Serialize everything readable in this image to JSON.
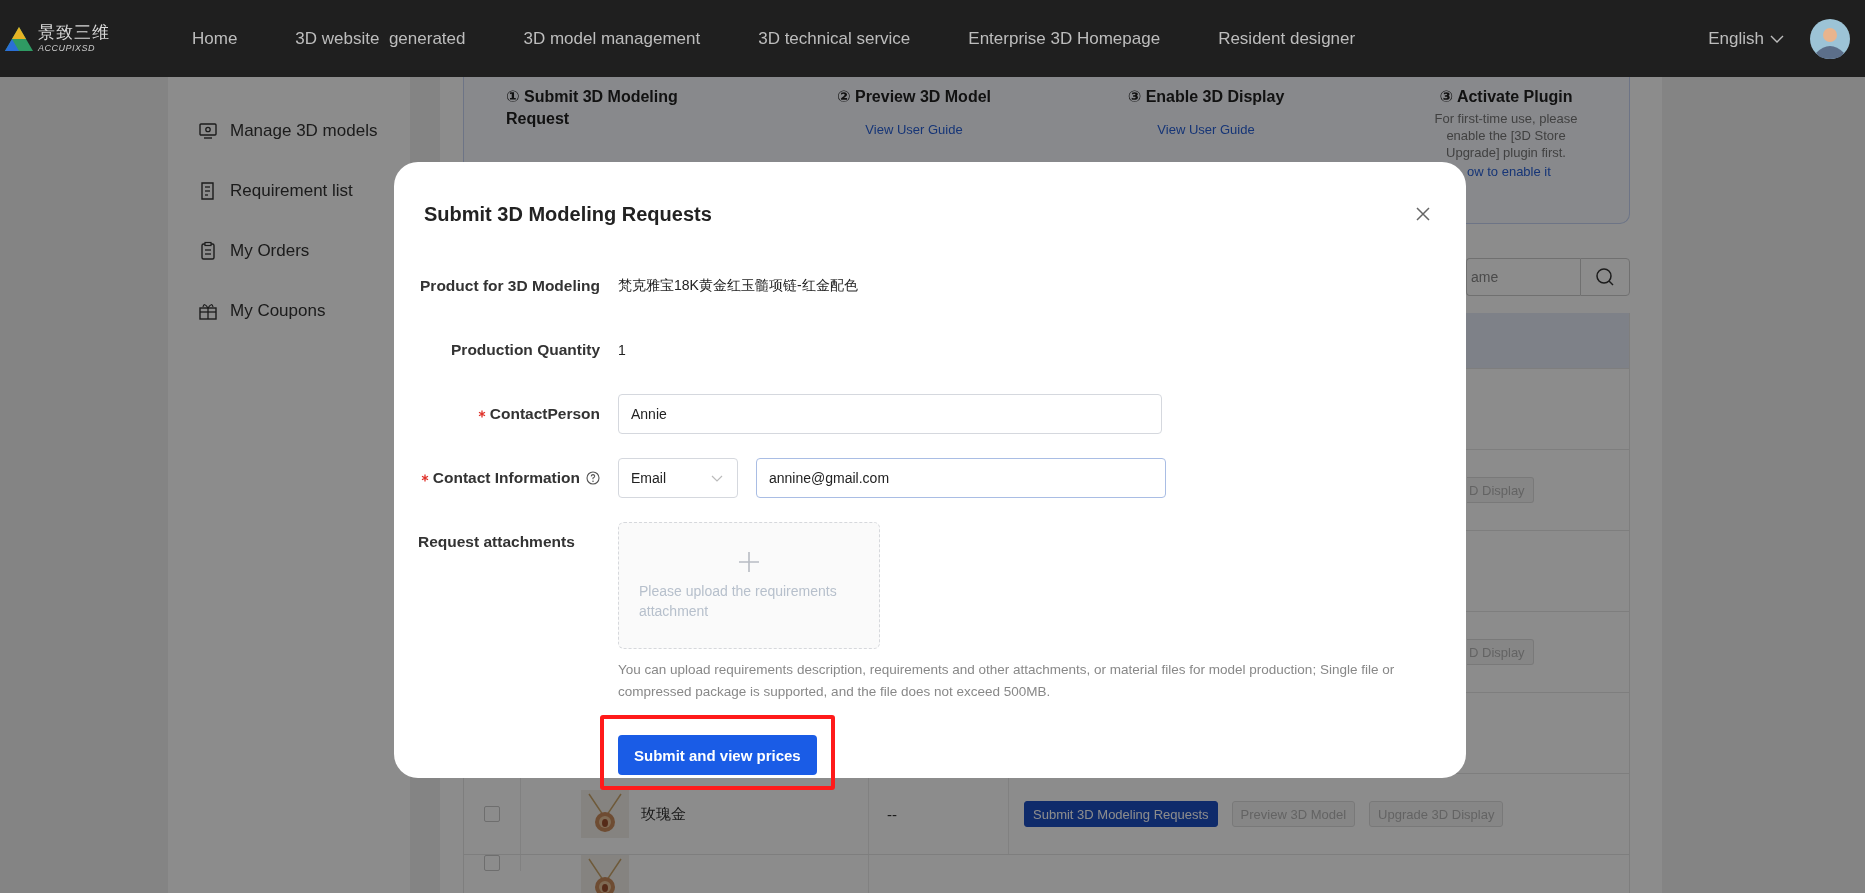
{
  "nav": {
    "logo": {
      "name": "景致三维",
      "sub": "ACCUPIXSD"
    },
    "items": [
      {
        "label": "Home",
        "selected": false
      },
      {
        "label": "3D website  generated",
        "selected": false
      },
      {
        "label": "3D model management",
        "selected": false
      },
      {
        "label": "3D technical service",
        "selected": false
      },
      {
        "label": "Enterprise 3D Homepage",
        "selected": false
      },
      {
        "label": "Resident designer",
        "selected": false
      }
    ],
    "language": "English"
  },
  "sidebar": {
    "items": [
      {
        "label": "Manage 3D models",
        "kind": "monitor"
      },
      {
        "label": "Requirement list",
        "kind": "document"
      },
      {
        "label": "My Orders",
        "kind": "clipboard"
      },
      {
        "label": "My Coupons",
        "kind": "gift"
      }
    ]
  },
  "steps": [
    {
      "title": "① Submit 3D Modeling Request"
    },
    {
      "title": "② Preview 3D Model",
      "link": "View User Guide"
    },
    {
      "title": "③ Enable 3D Display",
      "link": "View User Guide"
    },
    {
      "title": "③ Activate Plugin",
      "note": "For first-time use, please enable the [3D Store Upgrade] plugin first.",
      "link": "ow to enable it"
    }
  ],
  "search": {
    "placeholder": "ame"
  },
  "table": {
    "rows": [
      {
        "kind": "covered"
      },
      {
        "kind": "partial",
        "buttons": [
          {
            "label": "D Display",
            "kind": "disabled"
          }
        ]
      },
      {
        "kind": "covered"
      },
      {
        "kind": "partial",
        "buttons": [
          {
            "label": "D Display",
            "kind": "disabled"
          }
        ]
      },
      {
        "kind": "covered"
      },
      {
        "kind": "full",
        "checked": false,
        "name": "玫瑰金",
        "column_3": "--",
        "buttons": [
          {
            "label": "Submit 3D Modeling Requests",
            "kind": "primary"
          },
          {
            "label": "Preview 3D Model",
            "kind": "disabled"
          },
          {
            "label": "Upgrade 3D Display",
            "kind": "disabled"
          }
        ]
      },
      {
        "kind": "cut",
        "checked": false
      }
    ]
  },
  "modal": {
    "title": "Submit 3D Modeling Requests",
    "fields": [
      {
        "kind": "text",
        "label": "Product for 3D Modeling",
        "required": false,
        "help": false,
        "value": "梵克雅宝18K黄金红玉髓项链-红金配色"
      },
      {
        "kind": "text",
        "label": "Production Quantity",
        "required": false,
        "help": false,
        "value": "1"
      },
      {
        "kind": "input",
        "label": "ContactPerson",
        "required": true,
        "help": false,
        "value": "Annie"
      },
      {
        "kind": "contact",
        "label": "Contact Information",
        "required": true,
        "help": true,
        "select": "Email",
        "value": "annine@gmail.com"
      },
      {
        "kind": "upload",
        "label": "Request attachments",
        "required": false,
        "help": false,
        "placeholder": "Please upload the requirements attachment",
        "hint": "You can upload requirements description, requirements and other attachments, or material files for model production; Single file or compressed package is supported, and the file does not exceed 500MB."
      }
    ],
    "submit": "Submit and view prices",
    "highlight": true
  }
}
